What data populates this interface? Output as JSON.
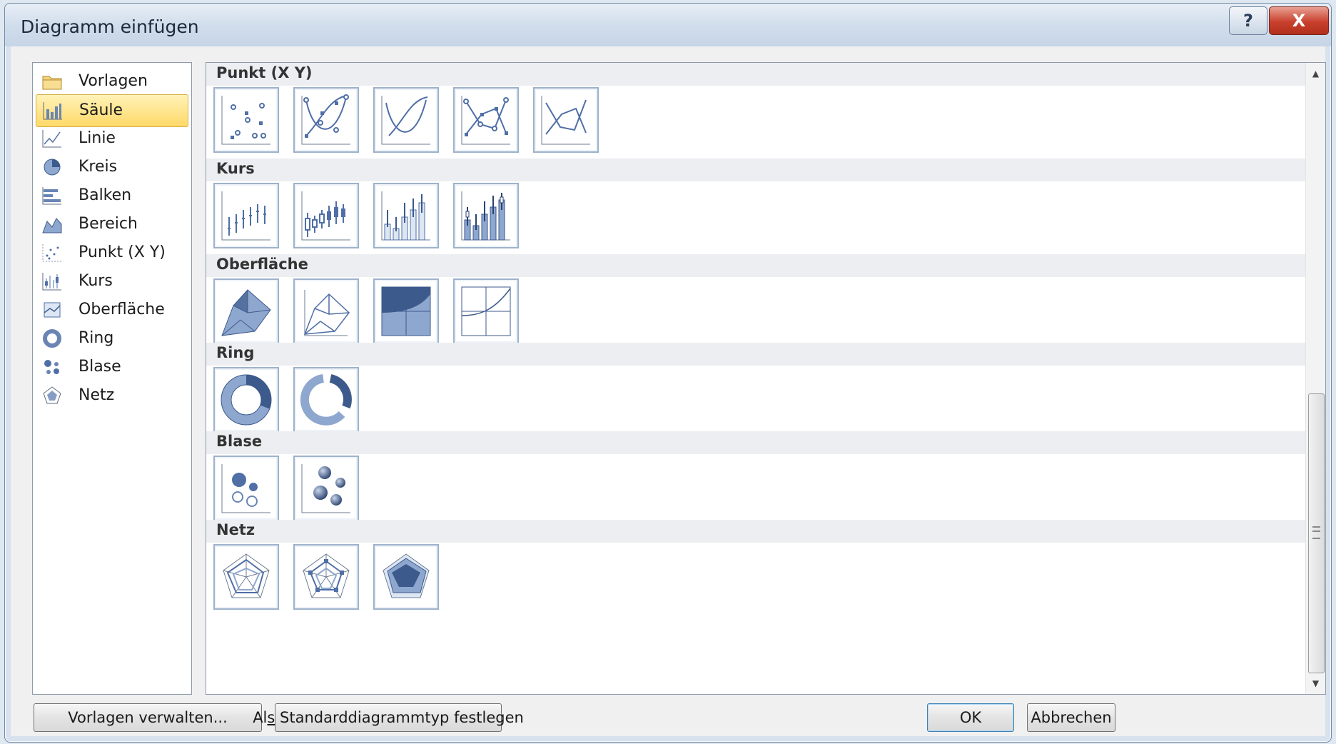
{
  "window": {
    "title": "Diagramm einfügen",
    "help_glyph": "?",
    "close_glyph": "X"
  },
  "categories": [
    {
      "label": "Vorlagen",
      "icon": "folder-icon",
      "selected": false
    },
    {
      "label": "Säule",
      "icon": "column-chart-icon",
      "selected": true
    },
    {
      "label": "Linie",
      "icon": "line-chart-icon",
      "selected": false
    },
    {
      "label": "Kreis",
      "icon": "pie-chart-icon",
      "selected": false
    },
    {
      "label": "Balken",
      "icon": "bar-chart-icon",
      "selected": false
    },
    {
      "label": "Bereich",
      "icon": "area-chart-icon",
      "selected": false
    },
    {
      "label": "Punkt (X Y)",
      "icon": "scatter-chart-icon",
      "selected": false
    },
    {
      "label": "Kurs",
      "icon": "stock-chart-icon",
      "selected": false
    },
    {
      "label": "Oberfläche",
      "icon": "surface-chart-icon",
      "selected": false
    },
    {
      "label": "Ring",
      "icon": "doughnut-chart-icon",
      "selected": false
    },
    {
      "label": "Blase",
      "icon": "bubble-chart-icon",
      "selected": false
    },
    {
      "label": "Netz",
      "icon": "radar-chart-icon",
      "selected": false
    }
  ],
  "sections": [
    {
      "title": "Punkt (X Y)",
      "thumbs": [
        "scatter-markers-icon",
        "scatter-smooth-markers-icon",
        "scatter-smooth-icon",
        "scatter-straight-markers-icon",
        "scatter-straight-icon"
      ]
    },
    {
      "title": "Kurs",
      "thumbs": [
        "stock-hlc-icon",
        "stock-ohlc-icon",
        "stock-vhlc-icon",
        "stock-vohlc-icon"
      ]
    },
    {
      "title": "Oberfläche",
      "thumbs": [
        "surface-3d-icon",
        "surface-wireframe-icon",
        "contour-icon",
        "contour-wireframe-icon"
      ]
    },
    {
      "title": "Ring",
      "thumbs": [
        "doughnut-icon",
        "exploded-doughnut-icon"
      ]
    },
    {
      "title": "Blase",
      "thumbs": [
        "bubble-icon",
        "bubble-3d-icon"
      ]
    },
    {
      "title": "Netz",
      "thumbs": [
        "radar-icon",
        "radar-markers-icon",
        "filled-radar-icon"
      ]
    }
  ],
  "buttons": {
    "manage_templates": "Vorlagen verwalten...",
    "set_default_prefix": "Al",
    "set_default_accel": "s",
    "set_default_rest": " Standarddiagrammtyp festlegen",
    "ok": "OK",
    "cancel": "Abbrechen"
  },
  "colors": {
    "selection": "#ffd968",
    "chart_blue": "#4f6fa6",
    "thumb_border": "#9eb2ca"
  }
}
